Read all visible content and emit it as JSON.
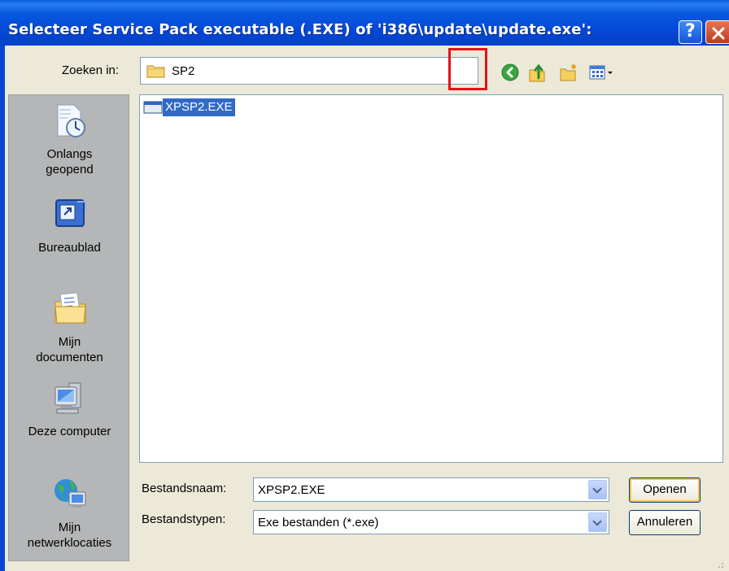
{
  "window": {
    "title": "Selecteer Service Pack executable (.EXE) of 'i386\\update\\update.exe':",
    "help_label": "?"
  },
  "toolbar": {
    "lookin_label": "Zoeken in:",
    "lookin_value": "SP2"
  },
  "places": [
    {
      "label_line1": "Onlangs",
      "label_line2": "geopend",
      "icon": "recent-documents-icon"
    },
    {
      "label_line1": "Bureaublad",
      "label_line2": "",
      "icon": "desktop-icon"
    },
    {
      "label_line1": "Mijn",
      "label_line2": "documenten",
      "icon": "my-documents-icon"
    },
    {
      "label_line1": "Deze computer",
      "label_line2": "",
      "icon": "my-computer-icon"
    },
    {
      "label_line1": "Mijn",
      "label_line2": "netwerklocaties",
      "icon": "network-places-icon"
    }
  ],
  "files": [
    {
      "name": "XPSP2.EXE",
      "icon": "executable-icon",
      "selected": true
    }
  ],
  "form": {
    "filename_label": "Bestandsnaam:",
    "filename_value": "XPSP2.EXE",
    "filetype_label": "Bestandstypen:",
    "filetype_value": "Exe bestanden (*.exe)",
    "open_label": "Openen",
    "cancel_label": "Annuleren"
  },
  "colors": {
    "titlebar": "#0447d4",
    "selection": "#316ac5",
    "highlight_box": "#e3111a"
  }
}
